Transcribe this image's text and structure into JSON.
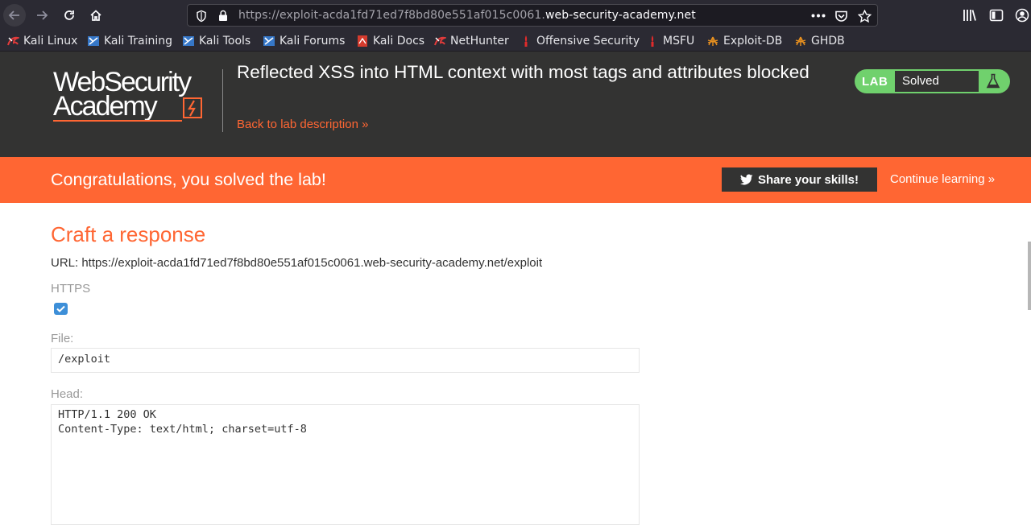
{
  "browser": {
    "url_prefix": "https://exploit-acda1fd71ed7f8bd80e551af015c0061.",
    "url_domain": "web-security-academy.net",
    "bookmarks": [
      {
        "label": "Kali Linux",
        "icon": "kali-icon"
      },
      {
        "label": "Kali Training",
        "icon": "kali-training-icon"
      },
      {
        "label": "Kali Tools",
        "icon": "kali-tools-icon"
      },
      {
        "label": "Kali Forums",
        "icon": "kali-forums-icon"
      },
      {
        "label": "Kali Docs",
        "icon": "kali-docs-icon"
      },
      {
        "label": "NetHunter",
        "icon": "nethunter-icon"
      },
      {
        "label": "Offensive Security",
        "icon": "offsec-icon"
      },
      {
        "label": "MSFU",
        "icon": "msfu-icon"
      },
      {
        "label": "Exploit-DB",
        "icon": "exploit-db-icon"
      },
      {
        "label": "GHDB",
        "icon": "ghdb-icon"
      }
    ]
  },
  "header": {
    "logo_line1": "WebSecurity",
    "logo_line2": "Academy",
    "lab_title": "Reflected XSS into HTML context with most tags and attributes blocked",
    "back_link": "Back to lab description »",
    "status_tag": "LAB",
    "status_text": "Solved"
  },
  "banner": {
    "message": "Congratulations, you solved the lab!",
    "share_label": "Share your skills!",
    "continue_label": "Continue learning »"
  },
  "form": {
    "heading": "Craft a response",
    "url_line": "URL: https://exploit-acda1fd71ed7f8bd80e551af015c0061.web-security-academy.net/exploit",
    "https_label": "HTTPS",
    "https_checked": true,
    "file_label": "File:",
    "file_value": "/exploit",
    "head_label": "Head:",
    "head_value": "HTTP/1.1 200 OK\nContent-Type: text/html; charset=utf-8"
  },
  "colors": {
    "accent": "#ff6633",
    "header_bg": "#333332",
    "solved_green": "#70d16d",
    "checkbox_blue": "#3d8fd8"
  }
}
